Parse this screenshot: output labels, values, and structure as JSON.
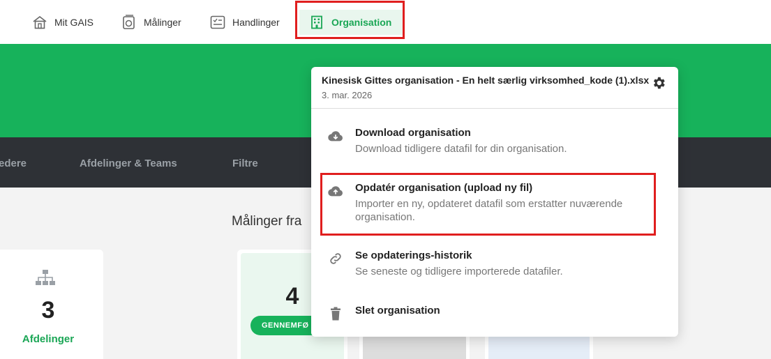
{
  "topnav": {
    "items": [
      {
        "label": "Mit GAIS",
        "icon": "home-icon"
      },
      {
        "label": "Målinger",
        "icon": "measurements-icon"
      },
      {
        "label": "Handlinger",
        "icon": "checklist-icon"
      },
      {
        "label": "Organisation",
        "icon": "building-icon",
        "active": true
      }
    ]
  },
  "subnav": {
    "items": [
      {
        "label": "edere"
      },
      {
        "label": "Afdelinger & Teams"
      },
      {
        "label": "Filtre"
      }
    ]
  },
  "content": {
    "section_title": "Målinger fra",
    "card_left": {
      "value": "3",
      "label": "Afdelinger",
      "icon": "org-chart-icon"
    },
    "card_mid": {
      "value": "4",
      "badge": "GENNEMFØ"
    }
  },
  "dropdown": {
    "filename": "Kinesisk Gittes organisation - En helt særlig virksomhed_kode (1).xlsx",
    "date": "3. mar. 2026",
    "items": [
      {
        "title": "Download organisation",
        "desc": "Download tidligere datafil for din organisation.",
        "icon": "cloud-download-icon"
      },
      {
        "title": "Opdatér organisation (upload ny fil)",
        "desc": "Importer en ny, opdateret datafil som erstatter nuværende organisation.",
        "icon": "cloud-upload-icon"
      },
      {
        "title": "Se opdaterings-historik",
        "desc": "Se seneste og tidligere importerede datafiler.",
        "icon": "link-icon"
      },
      {
        "title": "Slet organisation",
        "desc": "",
        "icon": "trash-icon"
      }
    ]
  },
  "colors": {
    "brand_green": "#17b25b",
    "dark_nav": "#2e3136",
    "highlight_red": "#e01e1e"
  }
}
